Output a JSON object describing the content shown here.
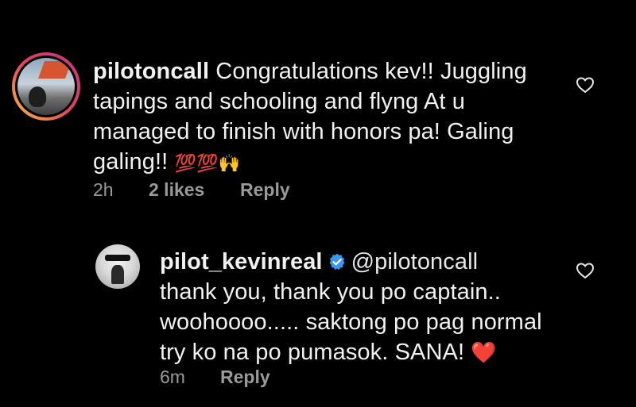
{
  "comment1": {
    "username": "pilotoncall",
    "text_line1": "Congratulations kev!! Juggling",
    "text_line2": "tapings and schooling and flyng At u",
    "text_line3": "managed to finish with honors pa! Galing",
    "text_line4": "galing!!",
    "emojis": "💯💯🙌",
    "time": "2h",
    "likes": "2 likes",
    "reply": "Reply"
  },
  "comment2": {
    "username": "pilot_kevinreal",
    "mention": "@pilotoncall",
    "text_line1": "thank you, thank you po captain..",
    "text_line2": "woohoooo..... saktong po pag normal",
    "text_line3": "try ko na po pumasok. SANA!",
    "emoji": "❤️",
    "time": "6m",
    "reply": "Reply"
  },
  "colors": {
    "background": "#000000",
    "text": "#f1f1f1",
    "meta": "#9a9a9a",
    "verified": "#3897f0",
    "heart_emoji": "#e0245e"
  },
  "icons": {
    "like": "heart-outline-icon",
    "verified": "verified-badge-icon"
  }
}
